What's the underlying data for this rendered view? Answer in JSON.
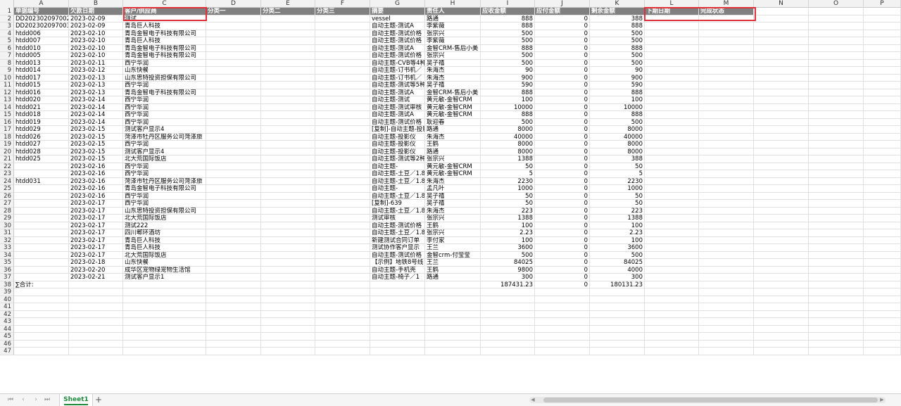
{
  "columns": [
    "A",
    "B",
    "C",
    "D",
    "E",
    "F",
    "G",
    "H",
    "I",
    "J",
    "K",
    "L",
    "M",
    "N",
    "O",
    "P"
  ],
  "header": [
    "单据编号",
    "欠款日期",
    "客户/供应商",
    "分类一",
    "分类二",
    "分类三",
    "摘要",
    "责任人",
    "应收金额",
    "应付金额",
    "剩余金额",
    "下期日期",
    "完成状态"
  ],
  "rows": [
    [
      "DD202302097002",
      "2023-02-09",
      "测试",
      "",
      "",
      "",
      "vessel",
      "路通",
      "888",
      "0",
      "388"
    ],
    [
      "DD202302097003",
      "2023-02-09",
      "青岛巨人科技",
      "",
      "",
      "",
      "自动主题-测试A",
      "李紫薇",
      "888",
      "0",
      "888"
    ],
    [
      "htdd006",
      "2023-02-10",
      "青岛金智电子科技有限公司",
      "",
      "",
      "",
      "自动主题-测试价格",
      "张宗兴",
      "500",
      "0",
      "500"
    ],
    [
      "htdd007",
      "2023-02-10",
      "青岛巨人科技",
      "",
      "",
      "",
      "自动主题-测试价格",
      "李紫薇",
      "500",
      "0",
      "500"
    ],
    [
      "htdd010",
      "2023-02-10",
      "青岛金智电子科技有限公司",
      "",
      "",
      "",
      "自动主题-测试A",
      "金智CRM-售后小美",
      "888",
      "0",
      "888"
    ],
    [
      "htdd005",
      "2023-02-10",
      "青岛金智电子科技有限公司",
      "",
      "",
      "",
      "自动主题-测试价格",
      "张宗兴",
      "500",
      "0",
      "500"
    ],
    [
      "htdd013",
      "2023-02-11",
      "西宁华润",
      "",
      "",
      "",
      "自动主题-CVB等4种",
      "吴子禧",
      "500",
      "0",
      "500"
    ],
    [
      "htdd014",
      "2023-02-12",
      "山东快餐",
      "",
      "",
      "",
      "自动主题-订书机／",
      "朱海杰",
      "90",
      "0",
      "90"
    ],
    [
      "htdd017",
      "2023-02-13",
      "山东思特投资担保有限公司",
      "",
      "",
      "",
      "自动主题-订书机／",
      "朱海杰",
      "900",
      "0",
      "900"
    ],
    [
      "htdd015",
      "2023-02-13",
      "西宁华润",
      "",
      "",
      "",
      "自动主题-测试等5种",
      "吴子禧",
      "590",
      "0",
      "590"
    ],
    [
      "htdd016",
      "2023-02-13",
      "青岛金智电子科技有限公司",
      "",
      "",
      "",
      "自动主题-测试A",
      "金智CRM-售后小美",
      "888",
      "0",
      "888"
    ],
    [
      "htdd020",
      "2023-02-14",
      "西宁华润",
      "",
      "",
      "",
      "自动主题-测试",
      "黄元敏-金智CRM",
      "100",
      "0",
      "100"
    ],
    [
      "htdd021",
      "2023-02-14",
      "西宁华润",
      "",
      "",
      "",
      "自动主题-测试审核",
      "黄元敏-金智CRM",
      "10000",
      "0",
      "10000"
    ],
    [
      "htdd018",
      "2023-02-14",
      "西宁华润",
      "",
      "",
      "",
      "自动主题-测试A",
      "黄元敏-金智CRM",
      "888",
      "0",
      "888"
    ],
    [
      "htdd019",
      "2023-02-14",
      "西宁华润",
      "",
      "",
      "",
      "自动主题-测试价格",
      "耿迎春",
      "500",
      "0",
      "500"
    ],
    [
      "htdd029",
      "2023-02-15",
      "测试客户显示4",
      "",
      "",
      "",
      "[复制]-自动主题-投影",
      "路通",
      "8000",
      "0",
      "8000"
    ],
    [
      "htdd026",
      "2023-02-15",
      "菏泽市牡丹区服务公司菏泽旅",
      "",
      "",
      "",
      "自动主题-投影仪",
      "朱海杰",
      "40000",
      "0",
      "40000"
    ],
    [
      "htdd027",
      "2023-02-15",
      "西宁华润",
      "",
      "",
      "",
      "自动主题-投影仪",
      "王鹤",
      "8000",
      "0",
      "8000"
    ],
    [
      "htdd028",
      "2023-02-15",
      "测试客户显示4",
      "",
      "",
      "",
      "自动主题-投影仪",
      "路通",
      "8000",
      "0",
      "8000"
    ],
    [
      "htdd025",
      "2023-02-15",
      "北大荒国际饭店",
      "",
      "",
      "",
      "自动主题-测试等2种",
      "张宗兴",
      "1388",
      "0",
      "388"
    ],
    [
      "",
      "2023-02-16",
      "西宁华润",
      "",
      "",
      "",
      "自动主题-",
      "黄元敏-金智CRM",
      "50",
      "0",
      "50"
    ],
    [
      "",
      "2023-02-16",
      "西宁华润",
      "",
      "",
      "",
      "自动主题-土豆／1.8",
      "黄元敏-金智CRM",
      "5",
      "0",
      "5"
    ],
    [
      "htdd031",
      "2023-02-16",
      "菏泽市牡丹区服务公司菏泽旅",
      "",
      "",
      "",
      "自动主题-土豆／1.8",
      "朱海杰",
      "2230",
      "0",
      "2230"
    ],
    [
      "",
      "2023-02-16",
      "青岛金智电子科技有限公司",
      "",
      "",
      "",
      "自动主题-",
      "孟凡叶",
      "1000",
      "0",
      "1000"
    ],
    [
      "",
      "2023-02-16",
      "西宁华润",
      "",
      "",
      "",
      "自动主题-土豆／1.8",
      "吴子禧",
      "50",
      "0",
      "50"
    ],
    [
      "",
      "2023-02-17",
      "西宁华润",
      "",
      "",
      "",
      "[复制]-639",
      "吴子禧",
      "50",
      "0",
      "50"
    ],
    [
      "",
      "2023-02-17",
      "山东思特投资担保有限公司",
      "",
      "",
      "",
      "自动主题-土豆／1.8",
      "朱海杰",
      "223",
      "0",
      "223"
    ],
    [
      "",
      "2023-02-17",
      "北大荒国际饭店",
      "",
      "",
      "",
      "测试审核",
      "张宗兴",
      "1388",
      "0",
      "1388"
    ],
    [
      "",
      "2023-02-17",
      "测试222",
      "",
      "",
      "",
      "自动主题-测试价格",
      "王鹤",
      "100",
      "0",
      "100"
    ],
    [
      "",
      "2023-02-17",
      "四川郫环酒坊",
      "",
      "",
      "",
      "自动主题-土豆／1.8",
      "张宗兴",
      "2.23",
      "0",
      "2.23"
    ],
    [
      "",
      "2023-02-17",
      "青岛巨人科技",
      "",
      "",
      "",
      "新建测试合同订单",
      "李付家",
      "100",
      "0",
      "100"
    ],
    [
      "",
      "2023-02-17",
      "青岛巨人科技",
      "",
      "",
      "",
      "测试协作客户显示",
      "王兰",
      "3600",
      "0",
      "3600"
    ],
    [
      "",
      "2023-02-17",
      "北大荒国际饭店",
      "",
      "",
      "",
      "自动主题-测试价格",
      "金智crm-付莹莹",
      "500",
      "0",
      "500"
    ],
    [
      "",
      "2023-02-18",
      "山东快餐",
      "",
      "",
      "",
      "【示例】地铁8号线",
      "王兰",
      "84025",
      "0",
      "84025"
    ],
    [
      "",
      "2023-02-20",
      "成华区宠物绿宠物生活馆",
      "",
      "",
      "",
      "自动主题-手机壳",
      "王鹤",
      "9800",
      "0",
      "4000"
    ],
    [
      "",
      "2023-02-21",
      "测试客户显示1",
      "",
      "",
      "",
      "自动主题-椅子／1",
      "路通",
      "300",
      "0",
      "300"
    ]
  ],
  "total_row": {
    "label": "∑合计:",
    "receivable": "187431.23",
    "payable": "0",
    "remaining": "180131.23"
  },
  "sheet_tab": "Sheet1",
  "add_tab": "+"
}
